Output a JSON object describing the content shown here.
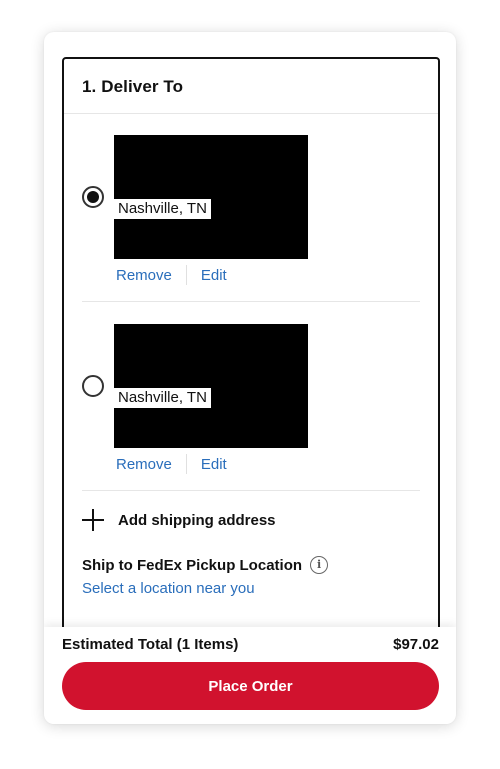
{
  "section": {
    "title": "1. Deliver To"
  },
  "addresses": [
    {
      "city": "Nashville, TN",
      "selected": true,
      "remove_label": "Remove",
      "edit_label": "Edit"
    },
    {
      "city": "Nashville, TN",
      "selected": false,
      "remove_label": "Remove",
      "edit_label": "Edit"
    }
  ],
  "add_address": {
    "label": "Add shipping address",
    "icon": "plus-icon"
  },
  "fedex": {
    "title": "Ship to FedEx Pickup Location",
    "info_icon": "info-icon",
    "link": "Select a location near you"
  },
  "footer": {
    "total_label": "Estimated Total (1 Items)",
    "total_value": "$97.02",
    "button_label": "Place Order"
  },
  "colors": {
    "accent": "#d1122e",
    "link": "#2a6ebb",
    "text": "#111111"
  }
}
